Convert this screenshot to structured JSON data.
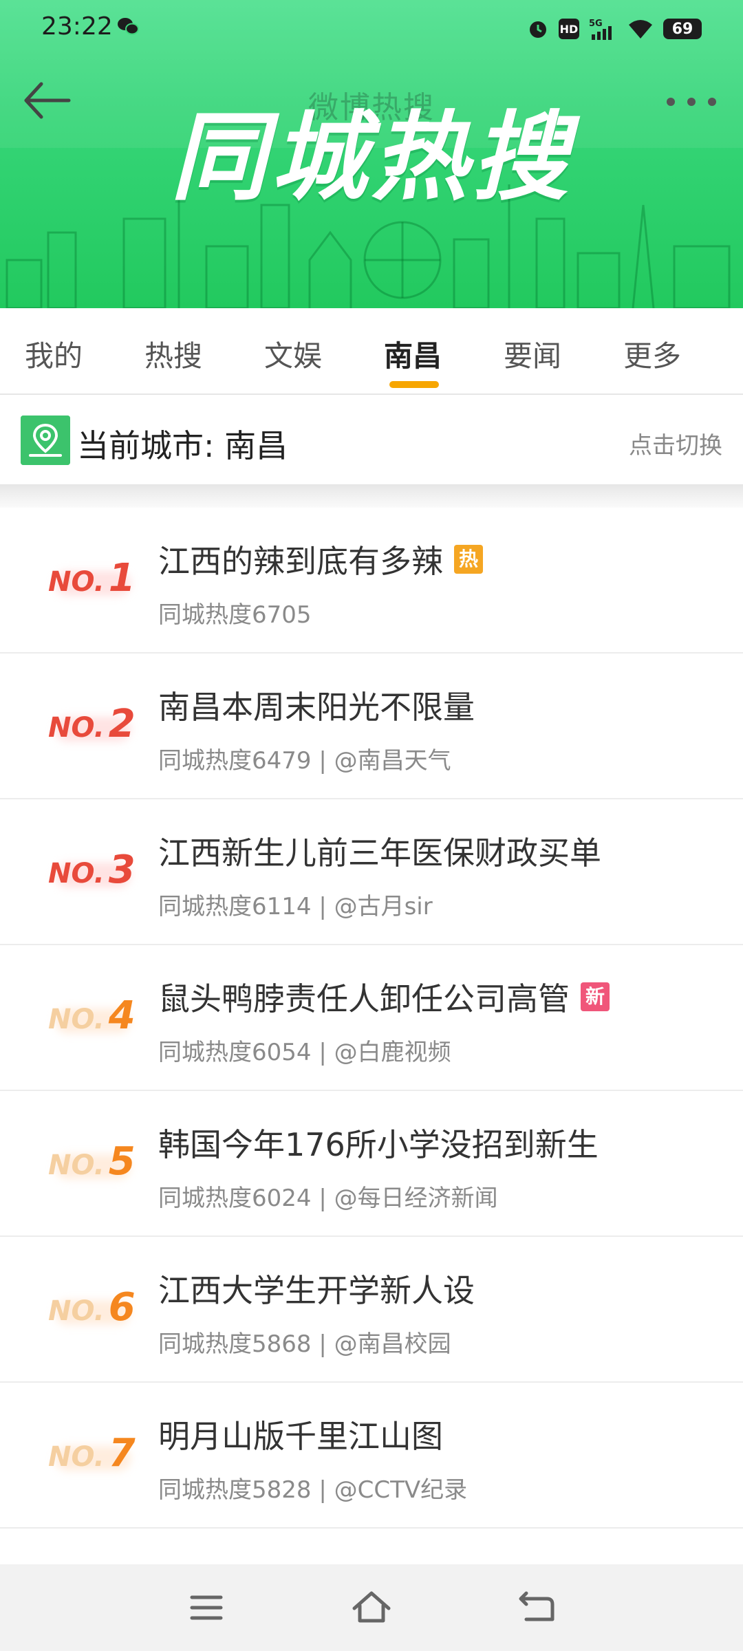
{
  "status": {
    "time": "23:22",
    "battery": "69",
    "hd": "HD",
    "network": "5G"
  },
  "header": {
    "subtitle": "微博热搜",
    "title": "同城热搜"
  },
  "tabs": [
    {
      "label": "我的"
    },
    {
      "label": "热搜"
    },
    {
      "label": "文娱"
    },
    {
      "label": "南昌",
      "active": true
    },
    {
      "label": "要闻"
    },
    {
      "label": "更多"
    }
  ],
  "city": {
    "label": "当前城市: 南昌",
    "switch_label": "点击切换"
  },
  "colors": {
    "green": "#22c95e",
    "tab_indicator": "#f7a600",
    "top_rank": "#e84a3b",
    "other_rank_no": "#f5cfa0",
    "other_rank_num": "#f5871f",
    "hot_badge": "#f5a623",
    "new_badge": "#f0567a"
  },
  "items": [
    {
      "rank_no": "NO.",
      "rank": "1",
      "title": "江西的辣到底有多辣",
      "badge": "热",
      "meta": "同城热度6705"
    },
    {
      "rank_no": "NO.",
      "rank": "2",
      "title": "南昌本周末阳光不限量",
      "badge": "",
      "meta": "同城热度6479 | @南昌天气"
    },
    {
      "rank_no": "NO.",
      "rank": "3",
      "title": "江西新生儿前三年医保财政买单",
      "badge": "",
      "meta": "同城热度6114 | @古月sir"
    },
    {
      "rank_no": "NO.",
      "rank": "4",
      "title": "鼠头鸭脖责任人卸任公司高管",
      "badge": "新",
      "meta": "同城热度6054 | @白鹿视频"
    },
    {
      "rank_no": "NO.",
      "rank": "5",
      "title": "韩国今年176所小学没招到新生",
      "badge": "",
      "meta": "同城热度6024 | @每日经济新闻"
    },
    {
      "rank_no": "NO.",
      "rank": "6",
      "title": "江西大学生开学新人设",
      "badge": "",
      "meta": "同城热度5868 | @南昌校园"
    },
    {
      "rank_no": "NO.",
      "rank": "7",
      "title": "明月山版千里江山图",
      "badge": "",
      "meta": "同城热度5828 | @CCTV纪录"
    }
  ],
  "icons": {
    "back": "arrow-left-icon",
    "more": "more-dots-icon",
    "location": "location-pin-icon",
    "nav_menu": "menu-icon",
    "nav_home": "home-icon",
    "nav_back": "return-icon"
  }
}
